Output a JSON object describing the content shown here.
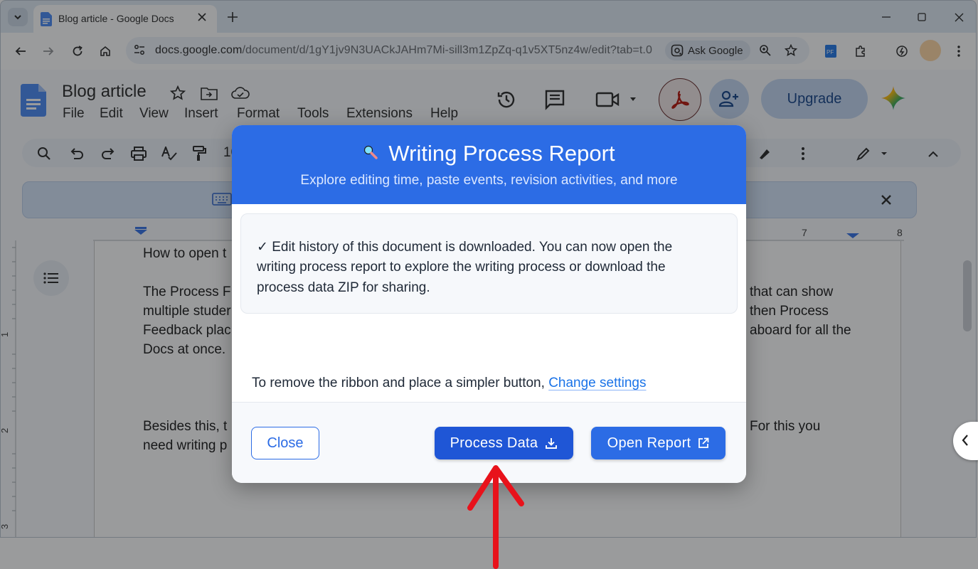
{
  "browser": {
    "tab_title": "Blog article - Google Docs",
    "url_host": "docs.google.com",
    "url_path": "/document/d/1gY1jv9N3UACkJAHm7Mi-sill3m1ZpZq-q1v5XT5nz4w/edit?tab=t.0",
    "ask_google_label": "Ask Google"
  },
  "docs": {
    "title": "Blog article",
    "menu": [
      "File",
      "Edit",
      "View",
      "Insert",
      "Format",
      "Tools",
      "Extensions",
      "Help"
    ],
    "upgrade_label": "Upgrade",
    "font_size_partial": "10",
    "ruler_top": [
      "7",
      "8"
    ],
    "ruler_left": [
      "1",
      "2",
      "3"
    ],
    "doc_lines_left": [
      "How to open t",
      "The Process F",
      "multiple studer",
      "Feedback plac",
      "Docs at once.",
      "Besides this, t",
      "need writing p"
    ],
    "doc_lines_right": [
      "that can show",
      "then Process",
      "aboard for all the",
      "For this you"
    ]
  },
  "modal": {
    "title": "Writing Process Report",
    "subtitle": "Explore editing time, paste events, revision activities, and more",
    "info_lines": [
      "✓ Edit history of this document is downloaded. You can now open the",
      "writing process report to explore the writing process or download the",
      "process data ZIP for sharing."
    ],
    "settings_text": "To remove the ribbon and place a simpler button, ",
    "settings_link": "Change settings",
    "close_label": "Close",
    "process_label": "Process Data",
    "open_label": "Open Report"
  },
  "colors": {
    "modal_header": "#2c6ce5",
    "process_button": "#1f56d6",
    "annotation_arrow": "#e8121b"
  }
}
